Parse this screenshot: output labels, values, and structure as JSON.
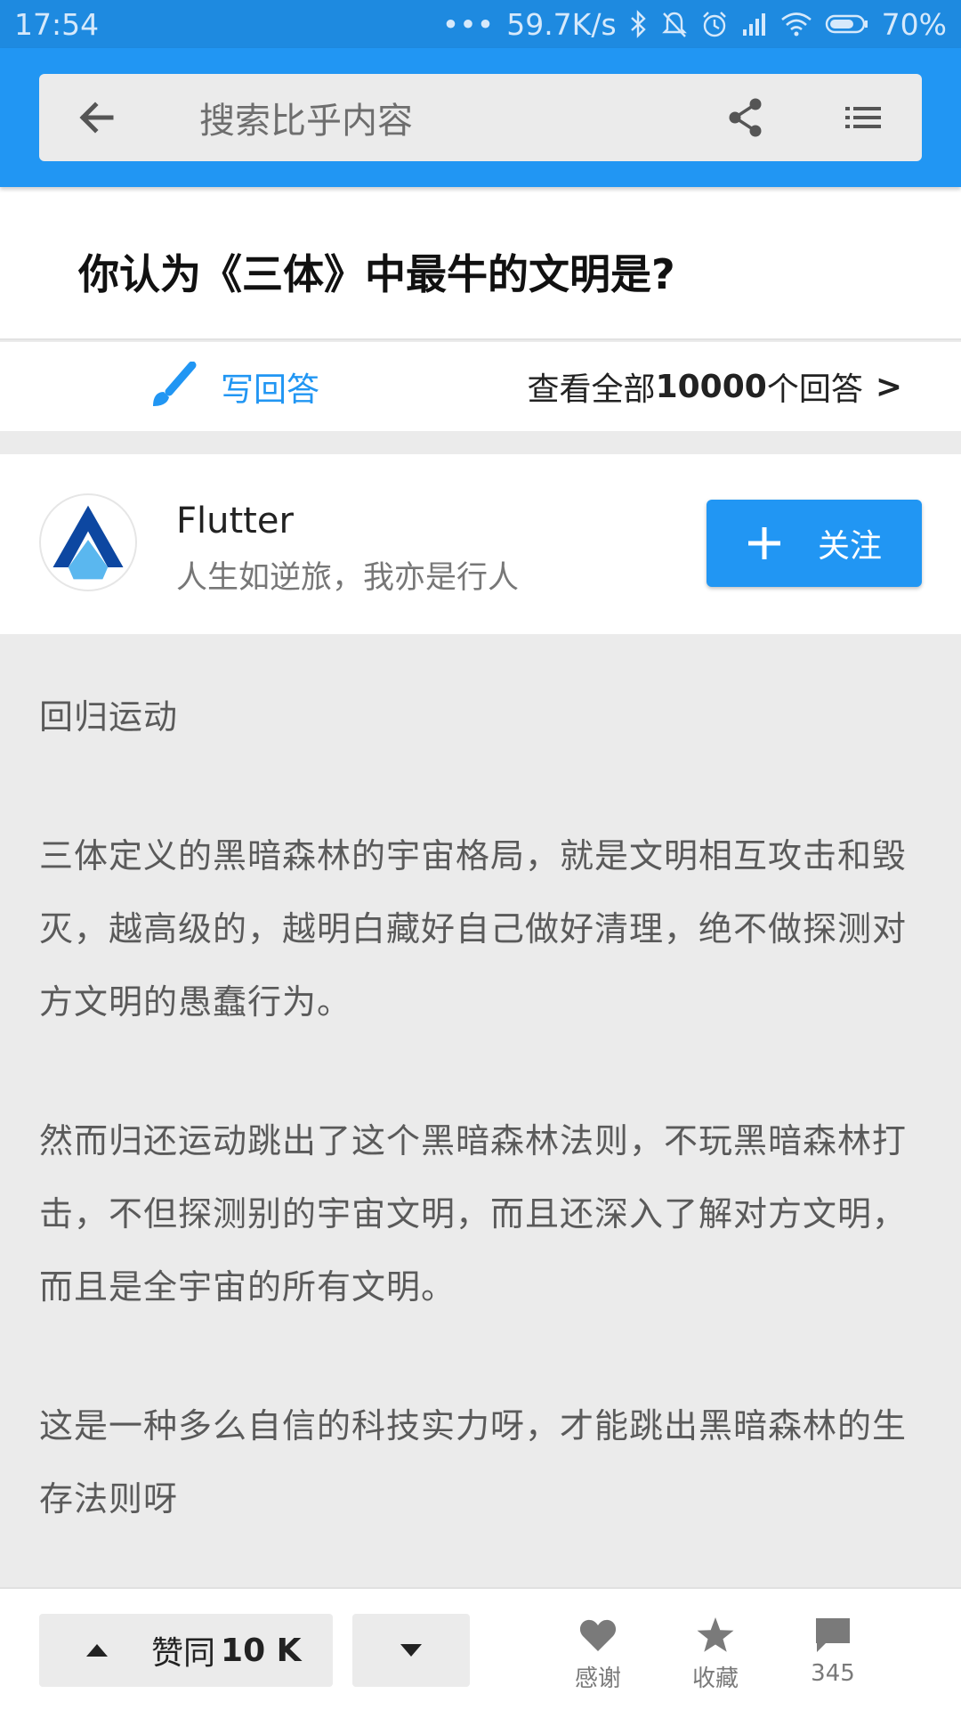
{
  "status_bar": {
    "time": "17:54",
    "dots": "•••",
    "net_speed": "59.7K/s",
    "battery": "70%"
  },
  "search": {
    "placeholder": "搜索比乎内容"
  },
  "question": {
    "title": "你认为《三体》中最牛的文明是?"
  },
  "answer_bar": {
    "write_label": "写回答",
    "view_prefix": "查看全部",
    "view_count": "10000",
    "view_suffix": "个回答",
    "view_arrow": ">"
  },
  "author": {
    "name": "Flutter",
    "bio": "人生如逆旅，我亦是行人",
    "follow_label": "关注"
  },
  "content": {
    "paragraphs": [
      "回归运动",
      "三体定义的黑暗森林的宇宙格局，就是文明相互攻击和毁灭，越高级的，越明白藏好自己做好清理，绝不做探测对方文明的愚蠢行为。",
      "然而归还运动跳出了这个黑暗森林法则，不玩黑暗森林打击，不但探测别的宇宙文明，而且还深入了解对方文明，而且是全宇宙的所有文明。",
      "这是一种多么自信的科技实力呀，才能跳出黑暗森林的生存法则呀"
    ]
  },
  "bottom_bar": {
    "upvote_label": "赞同",
    "upvote_count": "10 K",
    "thanks_label": "感谢",
    "collect_label": "收藏",
    "comments_count": "345"
  },
  "colors": {
    "primary": "#2196f3",
    "status_bar": "#1e8ae0",
    "background": "#ebebeb"
  }
}
